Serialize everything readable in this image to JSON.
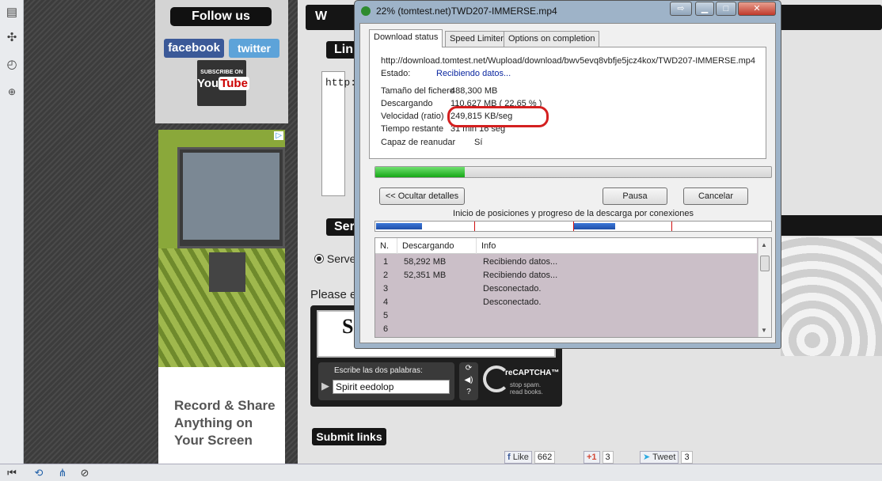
{
  "sidebar": {
    "follow_title": "Follow us",
    "facebook": "facebook",
    "twitter": "twitter",
    "youtube_sub": "SUBSCRIBE ON",
    "youtube_logo_you": "You",
    "youtube_logo_tube": "Tube",
    "ad_text": "Record & Share Anything on Your Screen"
  },
  "page": {
    "header_mark": "W",
    "links_heading": "Lin",
    "links_text": "http:",
    "servers_heading": "Ser",
    "server_radio_label": "Serve",
    "please_text": "Please e",
    "submit_label": "Submit links"
  },
  "captcha": {
    "image_word": "S",
    "prompt": "Escribe las dos palabras:",
    "value": "Spirit eedolop",
    "brand": "reCAPTCHA™",
    "tagline_1": "stop spam.",
    "tagline_2": "read books."
  },
  "social": {
    "like_label": "Like",
    "like_count": "662",
    "plus_label": "+1",
    "plus_count": "3",
    "tweet_label": "Tweet",
    "tweet_count": "3"
  },
  "idm": {
    "title": "22% (tomtest.net)TWD207-IMMERSE.mp4",
    "tabs": [
      "Download status",
      "Speed Limiter",
      "Options on completion"
    ],
    "url": "http://download.tomtest.net/Wupload/download/bwv5evq8vbfje5jcz4kox/TWD207-IMMERSE.mp4",
    "estado_label": "Estado:",
    "estado_value": "Recibiendo datos...",
    "rows": [
      {
        "label": "Tamaño del fichero",
        "value": "488,300  MB"
      },
      {
        "label": "Descargando",
        "value": "110,627  MB  ( 22,65 % )"
      },
      {
        "label": "Velocidad (ratio)",
        "value": "249,815  KB/seg"
      },
      {
        "label": "Tiempo restante",
        "value": "31 min 16 seg"
      },
      {
        "label": "Capaz de reanudar",
        "value": "Sí"
      }
    ],
    "progress_fraction": 0.2265,
    "buttons": {
      "hide": "<< Ocultar detalles",
      "pause": "Pausa",
      "cancel": "Cancelar"
    },
    "connections_label": "Inicio de posiciones y progreso de la descarga por conexiones",
    "table_headers": [
      "N.",
      "Descargando",
      "Info"
    ],
    "connections": [
      {
        "n": "1",
        "downloaded": "58,292  MB",
        "info": "Recibiendo datos..."
      },
      {
        "n": "2",
        "downloaded": "52,351  MB",
        "info": "Recibiendo datos..."
      },
      {
        "n": "3",
        "downloaded": "",
        "info": "Desconectado."
      },
      {
        "n": "4",
        "downloaded": "",
        "info": "Desconectado."
      },
      {
        "n": "5",
        "downloaded": "",
        "info": ""
      },
      {
        "n": "6",
        "downloaded": "",
        "info": ""
      }
    ],
    "highlight_color": "#d42020"
  }
}
